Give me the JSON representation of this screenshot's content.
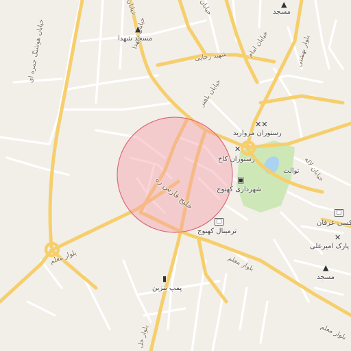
{
  "map": {
    "colors": {
      "background": "#f2efe9",
      "minor_road": "#ffffff",
      "major_road": "#f6cf6c",
      "park": "#cde8b6",
      "water": "#a9d3f0",
      "circle_fill": "#f4a0a8",
      "circle_stroke": "#e06a78"
    },
    "streets": {
      "khayaban_hooshang_hamreh": "خیابان هوشنگ جمره ای",
      "khayaban_top_left": "خیابان",
      "khayaban_shohada": "خیابان شهدا",
      "shahid_rajaei": "شهید رجایی",
      "khayaban_emam": "خیابان امام",
      "khayaban_bahonar": "خیابان باهنر",
      "bolvar_beheshti": "بلوار بهشتی",
      "khayaban_laleh": "خیابان لاله",
      "khalij_fars": "خلیج فارس ره",
      "bolvar_moallem_1": "بلوار معلم",
      "bolvar_moallem_2": "بلوار معلم",
      "bolvar_khaleej_bottom": "بلوار خل",
      "khayaban_top_center": "خیابان"
    },
    "pois": {
      "masjed_shohada": "مسجد شهدا",
      "masjed_top": "مسجد",
      "restoran_morvarid": "رستوران مروارید",
      "restoran_kakh": "رستوران کاخ",
      "toalet": "توالت",
      "shahrdari": "شهرداری کهنوج",
      "terminal": "ترمینال کهنوج",
      "pomp_benzin": "پمپ بنزین",
      "masjed_right": "مسجد",
      "park_amiri": "پارک امیرعلی",
      "terminal_erfan": "تاکسی عرفان"
    },
    "icons": {
      "mosque": "mosque-icon",
      "restaurant": "restaurant-icon",
      "town_hall": "town-hall-icon",
      "bus": "bus-icon",
      "fuel": "fuel-icon"
    }
  }
}
